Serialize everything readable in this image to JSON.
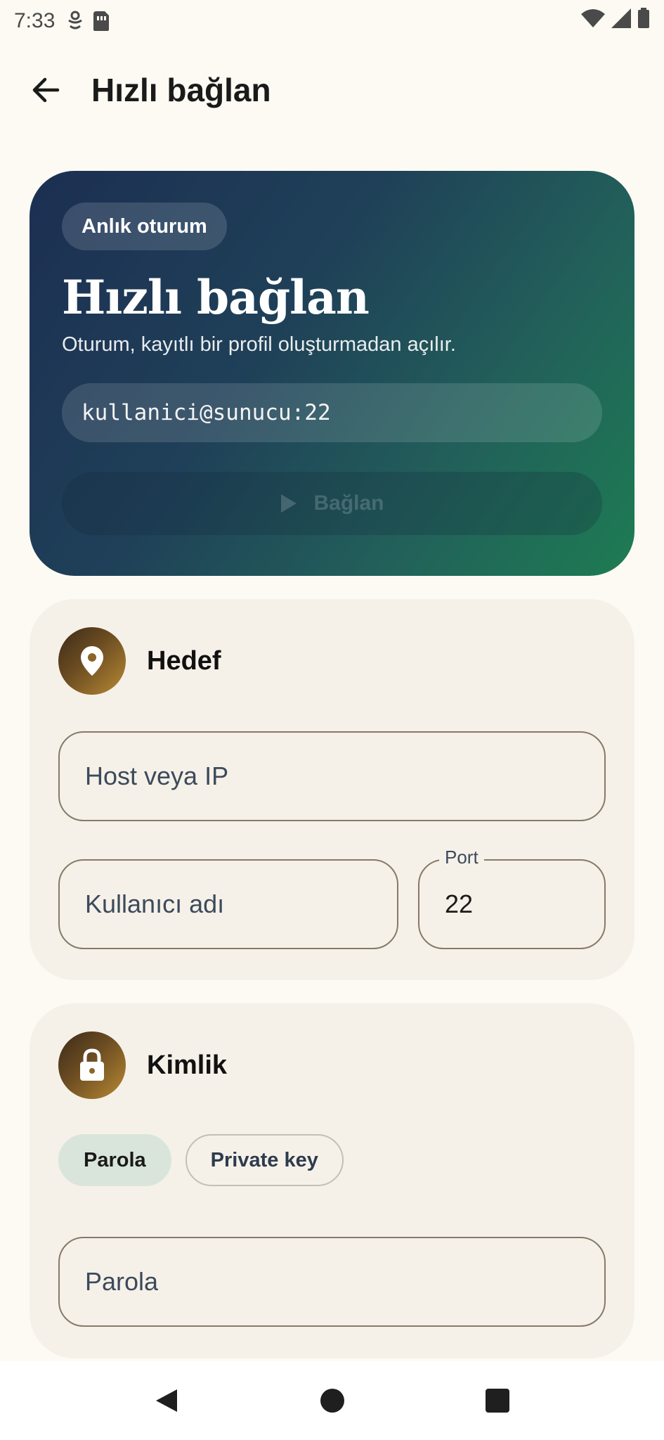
{
  "status_bar": {
    "time": "7:33",
    "icons": [
      "accessibility-icon",
      "sim-card-icon",
      "wifi-icon",
      "cell-signal-icon",
      "battery-icon"
    ]
  },
  "app_bar": {
    "back_icon": "arrow-left-icon",
    "title": "Hızlı bağlan"
  },
  "hero": {
    "chip": "Anlık oturum",
    "title": "Hızlı bağlan",
    "subtitle": "Oturum, kayıtlı bir profil oluşturmadan açılır.",
    "preview": "kullanici@sunucu:22",
    "connect_label": "Bağlan",
    "connect_icon": "play-icon",
    "gradient": [
      "#1c2f52",
      "#1d7c53"
    ]
  },
  "target_card": {
    "title": "Hedef",
    "icon": "location-pin-icon",
    "host_placeholder": "Host veya IP",
    "username_placeholder": "Kullanıcı adı",
    "port_label": "Port",
    "port_value": "22"
  },
  "identity_card": {
    "title": "Kimlik",
    "icon": "lock-icon",
    "auth_options": [
      {
        "label": "Parola",
        "selected": true
      },
      {
        "label": "Private key",
        "selected": false
      }
    ],
    "password_placeholder": "Parola"
  },
  "nav_bar": {
    "icons": [
      "back-triangle-icon",
      "home-circle-icon",
      "recents-square-icon"
    ]
  },
  "colors": {
    "background": "#fcfaf3",
    "card": "#f6f1e8",
    "accent_chip": "#d9e5da",
    "badge_gold": "#b88a33"
  }
}
